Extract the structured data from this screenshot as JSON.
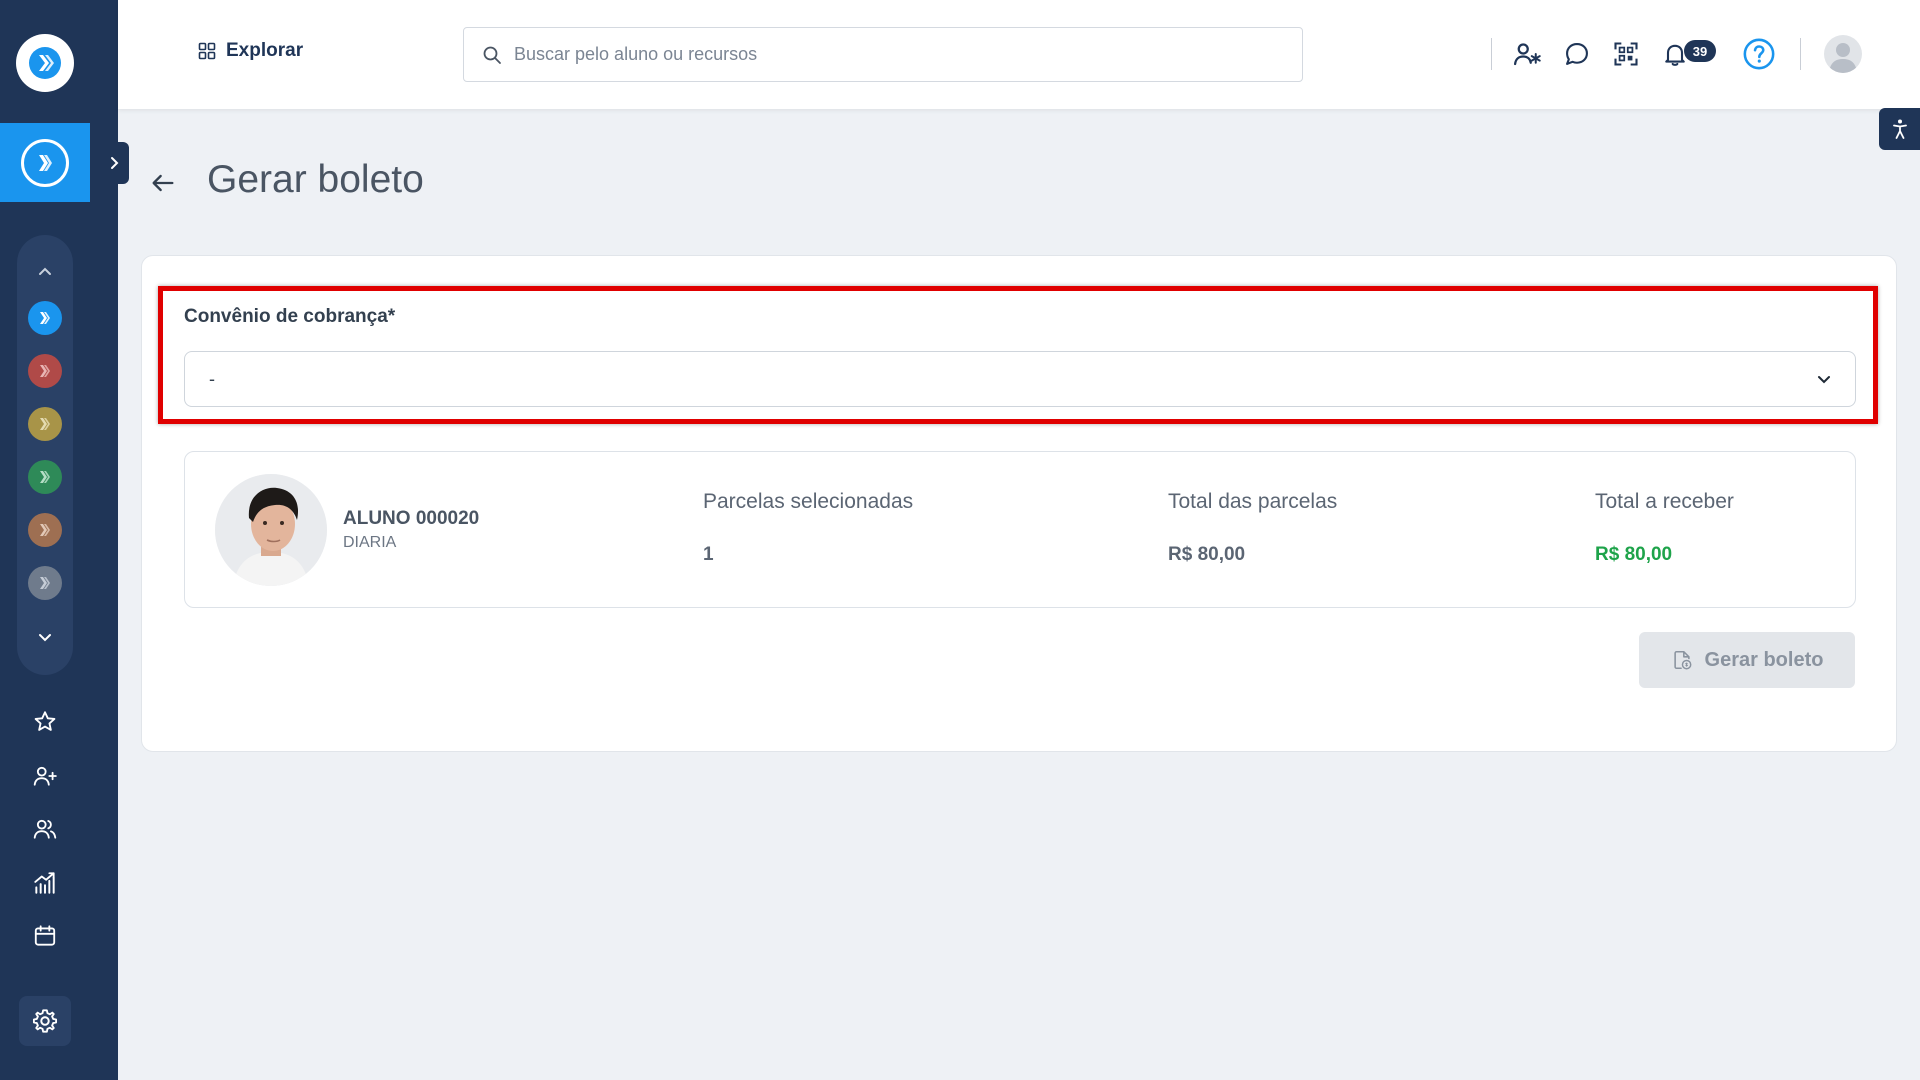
{
  "header": {
    "explore_label": "Explorar",
    "search_placeholder": "Buscar pelo aluno ou recursos",
    "notification_count": "39"
  },
  "page": {
    "title": "Gerar boleto"
  },
  "form": {
    "agreement_label": "Convênio de cobrança*",
    "agreement_value": "-"
  },
  "student": {
    "name": "ALUNO 000020",
    "plan": "DIARIA"
  },
  "summary": {
    "selected_label": "Parcelas selecionadas",
    "selected_value": "1",
    "total_label": "Total das parcelas",
    "total_value": "R$ 80,00",
    "receive_label": "Total a receber",
    "receive_value": "R$ 80,00"
  },
  "actions": {
    "generate_label": "Gerar boleto"
  },
  "colors": {
    "sidebar": "#1f3557",
    "accent": "#1a95ee",
    "highlight": "#e00000",
    "positive": "#1ea34a",
    "unit_dots": [
      "#1a95ee",
      "#c0504d",
      "#b8a04a",
      "#2e9a5e",
      "#b07a55",
      "#7a8595"
    ]
  },
  "icons": {
    "sidebar": [
      "star-icon",
      "user-plus-icon",
      "users-icon",
      "chart-icon",
      "calendar-icon",
      "gear-icon"
    ],
    "header": [
      "user-star-icon",
      "chat-icon",
      "qr-code-icon",
      "bell-icon",
      "help-icon"
    ]
  }
}
